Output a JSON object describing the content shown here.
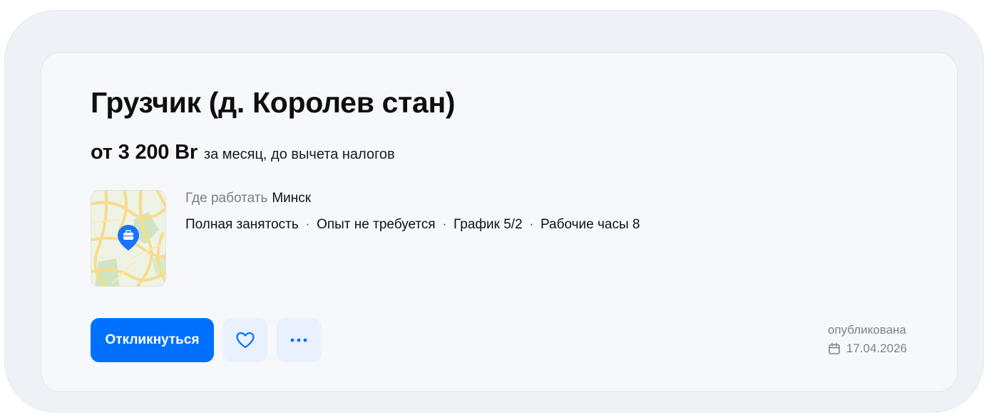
{
  "vacancy": {
    "title": "Грузчик (д. Королев стан)",
    "salary_amount": "от 3 200 Br",
    "salary_note": "за месяц, до вычета налогов",
    "where_label": "Где работать",
    "where_value": "Минск",
    "tags": [
      "Полная занятость",
      "Опыт не требуется",
      "График 5/2",
      "Рабочие часы 8"
    ],
    "tag_separator": "·"
  },
  "actions": {
    "apply_label": "Откликнуться",
    "favorite_icon": "heart-icon",
    "more_icon": "more-dots-icon"
  },
  "published": {
    "label": "опубликована",
    "date": "17.04.2026",
    "icon": "calendar-icon"
  },
  "colors": {
    "accent": "#0070ff",
    "icon_button_bg": "#e8f1fd",
    "card_bg": "#f6f8fb",
    "outer_bg": "#eef2f6",
    "muted_text": "#767f88"
  }
}
